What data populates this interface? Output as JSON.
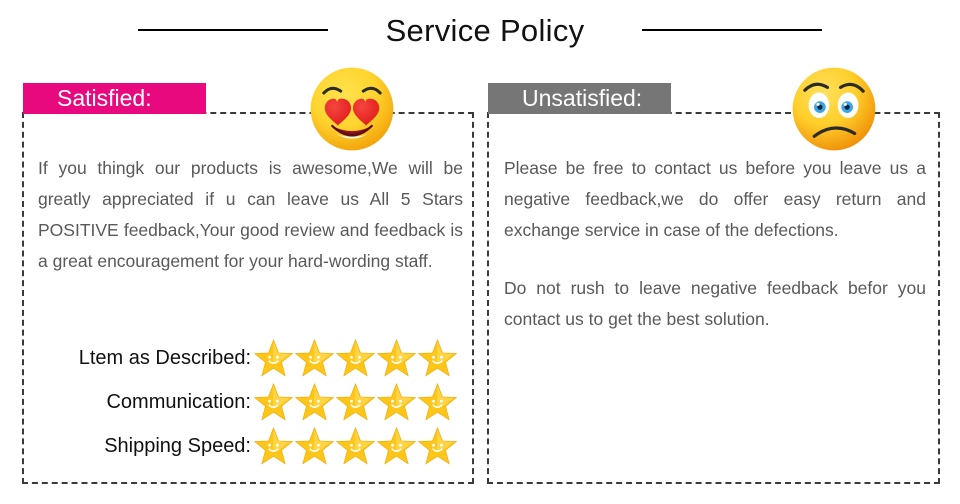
{
  "header": {
    "title": "Service Policy",
    "rule_left": "",
    "rule_right": ""
  },
  "panels": {
    "satisfied": {
      "badge_label": "Satisfied:",
      "badge_color": "#e8097e",
      "badge_text_color": "#ffffff",
      "emoji_name": "heart-eyes-smiling-face",
      "paragraph": "If you thingk our products is awesome,We will be greatly appreciated if u can leave us All 5 Stars POSITIVE feedback,Your good review and feedback is a great encouragement for your hard-wording staff.",
      "ratings": [
        {
          "label": "Ltem as Described:",
          "stars": 5
        },
        {
          "label": "Communication:",
          "stars": 5
        },
        {
          "label": "Shipping Speed:",
          "stars": 5
        }
      ],
      "star_color": "#ffc61a",
      "star_count_max": 5
    },
    "unsatisfied": {
      "badge_label": "Unsatisfied:",
      "badge_color": "#767676",
      "badge_text_color": "#ffffff",
      "emoji_name": "sad-frowning-face",
      "paragraph_1": "Please be free to contact us before you leave us a negative feedback,we do offer easy return and exchange service in case of the defections.",
      "paragraph_2": "Do not rush to leave negative feedback befor you contact us to get the best solution."
    }
  },
  "styles": {
    "body_text_color": "#595959",
    "label_text_color": "#111111",
    "border_style": "dashed",
    "border_color": "#3a3a3a",
    "background": "#ffffff"
  }
}
